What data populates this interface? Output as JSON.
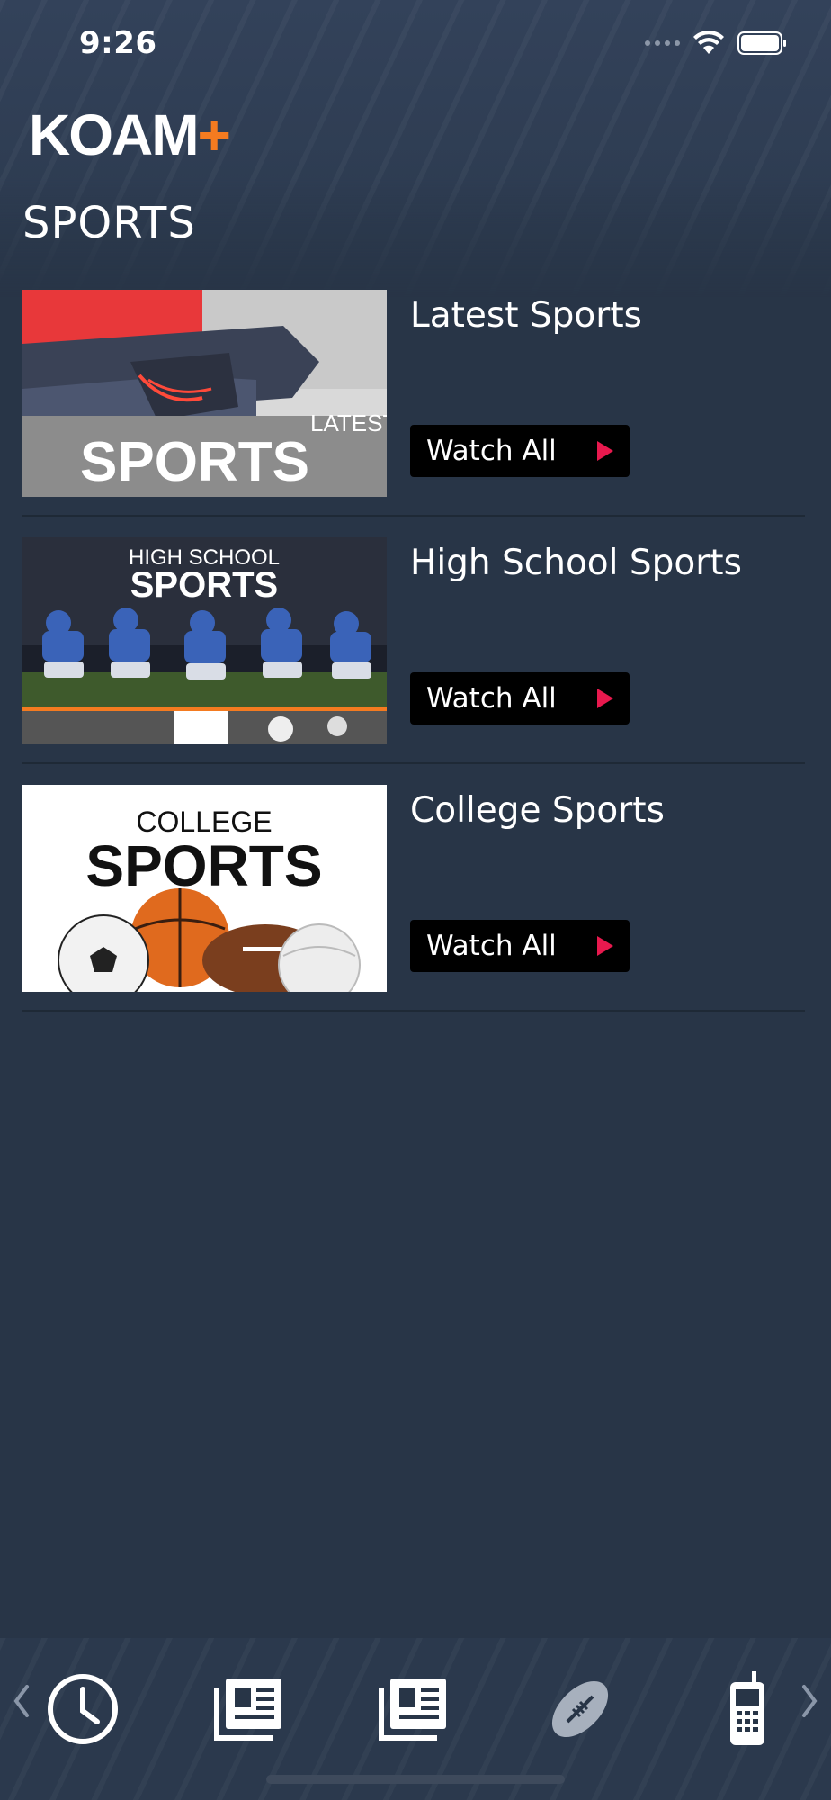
{
  "status_bar": {
    "time": "9:26"
  },
  "app": {
    "logo_text": "KOAM",
    "logo_plus": "+",
    "page_title": "SPORTS"
  },
  "colors": {
    "background": "#283547",
    "accent_orange": "#f47b20",
    "play_pink": "#e8194e"
  },
  "sections": [
    {
      "title": "Latest Sports",
      "button": "Watch All",
      "thumb_top": "LATEST",
      "thumb_main": "SPORTS"
    },
    {
      "title": "High School Sports",
      "button": "Watch All",
      "thumb_top": "HIGH SCHOOL",
      "thumb_main": "SPORTS"
    },
    {
      "title": "College Sports",
      "button": "Watch All",
      "thumb_top": "COLLEGE",
      "thumb_main": "SPORTS"
    }
  ],
  "tabbar": {
    "icons": [
      "clock-icon",
      "news-icon",
      "news-icon",
      "football-icon",
      "phone-icon"
    ]
  }
}
